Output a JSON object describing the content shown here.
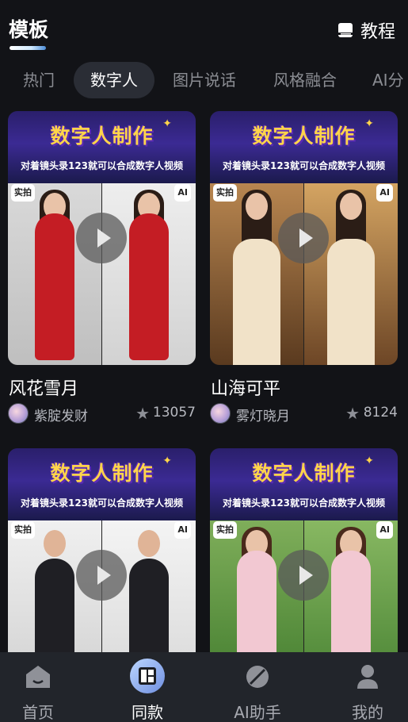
{
  "header": {
    "title": "模板",
    "tutorial_label": "教程"
  },
  "tabs": [
    {
      "label": "热门",
      "active": false
    },
    {
      "label": "数字人",
      "active": true
    },
    {
      "label": "图片说话",
      "active": false
    },
    {
      "label": "风格融合",
      "active": false
    },
    {
      "label": "AI分",
      "active": false
    }
  ],
  "banner": {
    "title": "数字人制作",
    "subtitle": "对着镜头录123就可以合成数字人视频"
  },
  "badges": {
    "real": "实拍",
    "ai": "AI"
  },
  "cards": [
    {
      "title": "风花雪月",
      "author": "紫腚发财",
      "count": "13057"
    },
    {
      "title": "山海可平",
      "author": "雾灯晓月",
      "count": "8124"
    },
    {
      "title": "",
      "author": "",
      "count": ""
    },
    {
      "title": "",
      "author": "",
      "count": ""
    }
  ],
  "nav": [
    {
      "label": "首页",
      "icon": "home-icon",
      "active": false
    },
    {
      "label": "同款",
      "icon": "template-grid-icon",
      "active": true
    },
    {
      "label": "AI助手",
      "icon": "ai-assistant-icon",
      "active": false
    },
    {
      "label": "我的",
      "icon": "profile-icon",
      "active": false
    }
  ],
  "colors": {
    "background": "#121317",
    "tab_active_bg": "#2a2d35",
    "banner_title": "#ffd54a",
    "nav_bg": "#22252b"
  }
}
